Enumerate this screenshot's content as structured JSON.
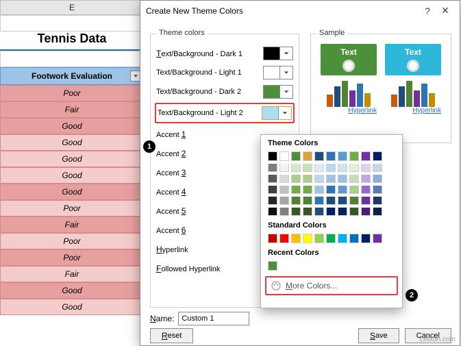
{
  "sheet": {
    "col_label": "E",
    "title": "Tennis Data",
    "header": "Footwork Evaluation",
    "rows": [
      "Poor",
      "Fair",
      "Good",
      "Good",
      "Good",
      "Good",
      "Good",
      "Poor",
      "Fair",
      "Poor",
      "Poor",
      "Fair",
      "Good",
      "Good"
    ]
  },
  "dialog": {
    "title": "Create New Theme Colors",
    "help": "?",
    "close": "✕",
    "group_theme": "Theme colors",
    "group_sample": "Sample",
    "items": {
      "tb_dark1": "Text/Background - Dark 1",
      "tb_light1": "Text/Background - Light 1",
      "tb_dark2": "Text/Background - Dark 2",
      "tb_light2": "Text/Background - Light 2",
      "a1": "Accent 1",
      "a2": "Accent 2",
      "a3": "Accent 3",
      "a4": "Accent 4",
      "a5": "Accent 5",
      "a6": "Accent 6",
      "hy": "Hyperlink",
      "fh": "Followed Hyperlink"
    },
    "swatch_colors": {
      "tb_dark1": "#000000",
      "tb_light1": "#ffffff",
      "tb_dark2": "#4c903c",
      "tb_light2": "#a8dff2"
    },
    "sample_text": "Text",
    "sample_link1": "Hyperlink",
    "sample_link2": "Hyperlink",
    "name_label": "Name:",
    "name_value": "Custom 1",
    "reset": "Reset",
    "save": "Save",
    "cancel": "Cancel"
  },
  "picker": {
    "h_theme": "Theme Colors",
    "h_std": "Standard Colors",
    "h_recent": "Recent Colors",
    "more": "More Colors...",
    "theme_row": [
      "#000000",
      "#ffffff",
      "#4c903c",
      "#e2a03f",
      "#1f4e79",
      "#2e75b6",
      "#5b9bd5",
      "#70ad47",
      "#7030a0",
      "#002060"
    ],
    "theme_shades": [
      [
        "#7f7f7f",
        "#f2f2f2",
        "#d5e8d0",
        "#c5e0b4",
        "#deebf7",
        "#bdd7ee",
        "#d0e3f1",
        "#e2f0d9",
        "#e1d3ee",
        "#c7d4ea"
      ],
      [
        "#595959",
        "#d9d9d9",
        "#a9d08e",
        "#a9d18e",
        "#bdd7ee",
        "#9dc3e6",
        "#9cc3e5",
        "#c5e0b4",
        "#c3a6e0",
        "#8faadc"
      ],
      [
        "#404040",
        "#bfbfbf",
        "#70ad47",
        "#70ad47",
        "#9dc3e6",
        "#2e75b6",
        "#5b9bd5",
        "#a9d18e",
        "#9966cc",
        "#5b7bb4"
      ],
      [
        "#262626",
        "#a6a6a6",
        "#548235",
        "#548235",
        "#2e75b6",
        "#1f4e79",
        "#1f4e79",
        "#548235",
        "#7030a0",
        "#203864"
      ],
      [
        "#0d0d0d",
        "#808080",
        "#385723",
        "#385723",
        "#1f4e79",
        "#002060",
        "#002060",
        "#385723",
        "#4a1f6f",
        "#0f1f3f"
      ]
    ],
    "standard": [
      "#c00000",
      "#ff0000",
      "#ffc000",
      "#ffff00",
      "#92d050",
      "#00b050",
      "#00b0f0",
      "#0070c0",
      "#002060",
      "#7030a0"
    ],
    "recent": [
      "#4c903c"
    ]
  },
  "watermark": "cxsxdn.com"
}
